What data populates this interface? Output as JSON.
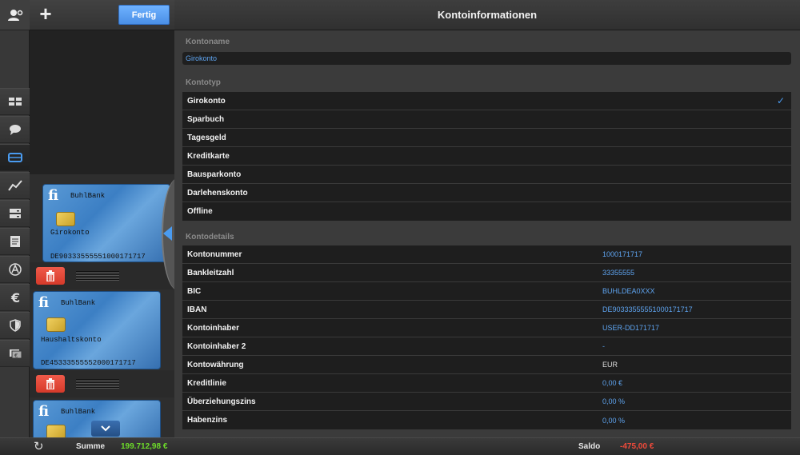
{
  "colors": {
    "accent": "#4a9bf0",
    "value_blue": "#5ea4f0",
    "sum_green": "#6ddc2a",
    "saldo_red": "#f04a3a",
    "delete_red": "#e04a3a"
  },
  "header": {
    "title": "Kontoinformationen",
    "done_label": "Fertig",
    "add_icon": "plus-icon"
  },
  "rail": {
    "items": [
      "dashboard-icon",
      "chat-icon",
      "card-icon",
      "chart-icon",
      "storage-icon",
      "document-icon",
      "sign-icon",
      "euro-icon",
      "shield-icon",
      "cash-icon"
    ]
  },
  "cards": [
    {
      "logo": "fi",
      "bank": "BuhlBank",
      "type": "Girokonto",
      "iban": "DE90333555551000171717"
    },
    {
      "logo": "fi",
      "bank": "BuhlBank",
      "type": "Haushaltskonto",
      "iban": "DE45333555552000171717"
    },
    {
      "logo": "fi",
      "bank": "BuhlBank"
    }
  ],
  "form": {
    "name_section": "Kontoname",
    "name_value": "Girokonto",
    "type_section": "Kontotyp",
    "types": [
      {
        "label": "Girokonto",
        "selected": true
      },
      {
        "label": "Sparbuch"
      },
      {
        "label": "Tagesgeld"
      },
      {
        "label": "Kreditkarte"
      },
      {
        "label": "Bausparkonto"
      },
      {
        "label": "Darlehenskonto"
      },
      {
        "label": "Offline"
      }
    ],
    "check_mark": "✓",
    "details_section": "Kontodetails",
    "details": [
      {
        "label": "Kontonummer",
        "value": "1000171717"
      },
      {
        "label": "Bankleitzahl",
        "value": "33355555"
      },
      {
        "label": "BIC",
        "value": "BUHLDEA0XXX"
      },
      {
        "label": "IBAN",
        "value": "DE90333555551000171717"
      },
      {
        "label": "Kontoinhaber",
        "value": "USER-DD171717"
      },
      {
        "label": "Kontoinhaber 2",
        "value": "-"
      },
      {
        "label": "Kontowährung",
        "value": "EUR"
      },
      {
        "label": "Kreditlinie",
        "value": "0,00 €"
      },
      {
        "label": "Überziehungszins",
        "value": "0,00 %"
      },
      {
        "label": "Habenzins",
        "value": "0,00 %"
      }
    ]
  },
  "footer": {
    "sum_label": "Summe",
    "sum_value": "199.712,98 €",
    "saldo_label": "Saldo",
    "saldo_value": "-475,00 €"
  }
}
